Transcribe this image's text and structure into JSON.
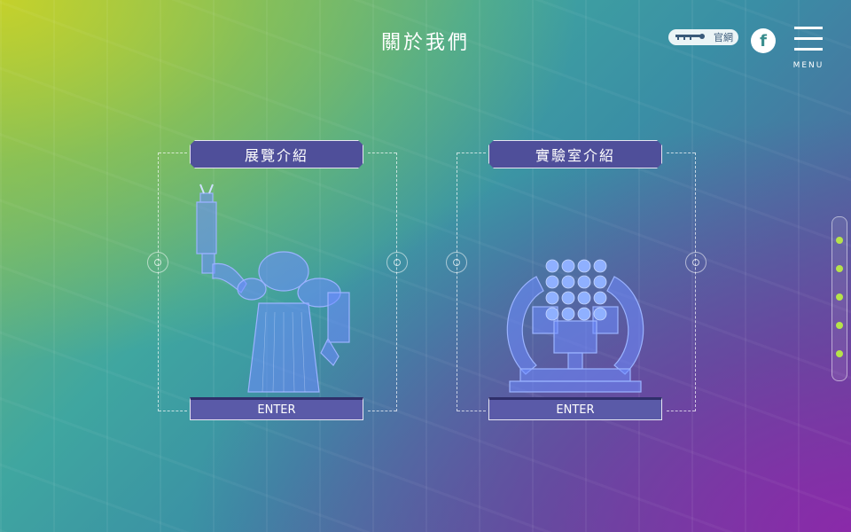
{
  "header": {
    "title": "關於我們",
    "site_link_label": "官網",
    "facebook_glyph": "f",
    "menu_label": "MENU"
  },
  "cards": [
    {
      "title": "展覽介紹",
      "enter_label": "ENTER"
    },
    {
      "title": "實驗室介紹",
      "enter_label": "ENTER"
    }
  ],
  "side_nav": {
    "dots": 5,
    "dot_color": "#b6e34a"
  },
  "colors": {
    "tab_bg": "#4f4f9a",
    "enter_bg": "#5a5aa8",
    "blueprint": "#7a9cff"
  },
  "icons": [
    "site-logo-icon",
    "facebook-icon",
    "menu-icon",
    "reticle-icon",
    "robot-arm-icon",
    "lab-machine-icon"
  ]
}
